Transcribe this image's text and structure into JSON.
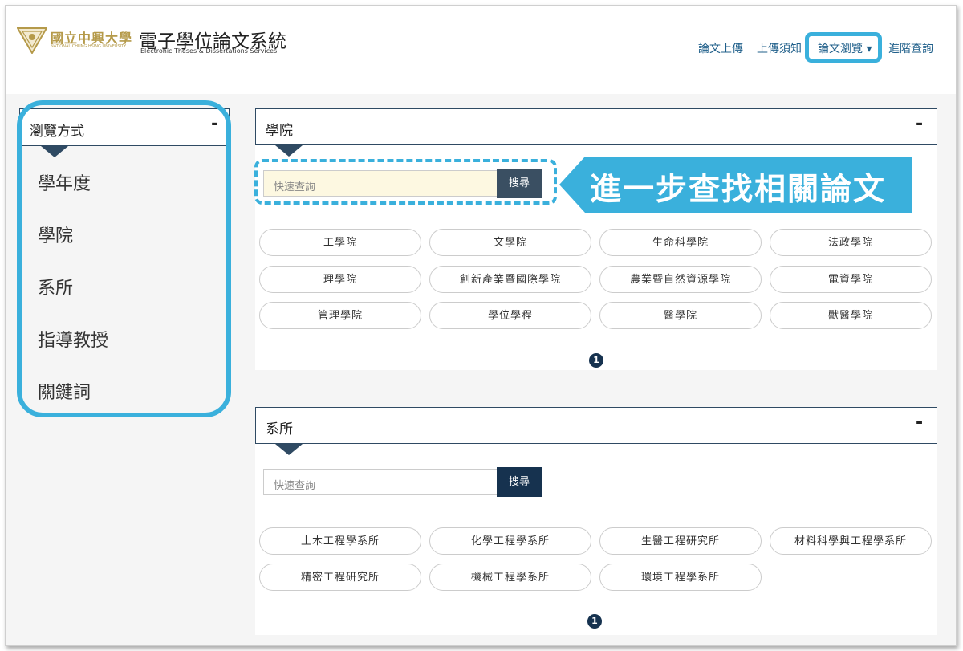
{
  "header": {
    "school_name": "國立中興大學",
    "school_name_en": "NATIONAL CHUNG HSING UNIVERSITY",
    "system_title": "電子學位論文系統",
    "system_subtitle": "Electronic Theses & Dissertations Services",
    "nav": [
      {
        "label": "論文上傳"
      },
      {
        "label": "上傳須知"
      },
      {
        "label": "論文瀏覽 ▾"
      },
      {
        "label": "進階查詢"
      }
    ]
  },
  "sidebar": {
    "title": "瀏覽方式",
    "collapse_symbol": "-",
    "items": [
      {
        "label": "學年度"
      },
      {
        "label": "學院"
      },
      {
        "label": "系所"
      },
      {
        "label": "指導教授"
      },
      {
        "label": "關鍵詞"
      }
    ]
  },
  "college_panel": {
    "title": "學院",
    "collapse_symbol": "-",
    "search_placeholder": "快速查詢",
    "search_button": "搜尋",
    "items": [
      "工學院",
      "文學院",
      "生命科學院",
      "法政學院",
      "理學院",
      "創新產業暨國際學院",
      "農業暨自然資源學院",
      "電資學院",
      "管理學院",
      "學位學程",
      "醫學院",
      "獸醫學院"
    ],
    "page": "1"
  },
  "dept_panel": {
    "title": "系所",
    "collapse_symbol": "-",
    "search_placeholder": "快速查詢",
    "search_button": "搜尋",
    "items": [
      "土木工程學系所",
      "化學工程學系所",
      "生醫工程研究所",
      "材料科學與工程學系所",
      "精密工程研究所",
      "機械工程學系所",
      "環境工程學系所"
    ],
    "page": "1"
  },
  "annotation": {
    "callout_text": "進一步查找相關論文",
    "highlight_color": "#3ab0dc"
  },
  "colors": {
    "navy": "#16324f",
    "link": "#1f5f8a",
    "accent": "#3ab0dc",
    "logo_gold": "#b59a4a"
  }
}
